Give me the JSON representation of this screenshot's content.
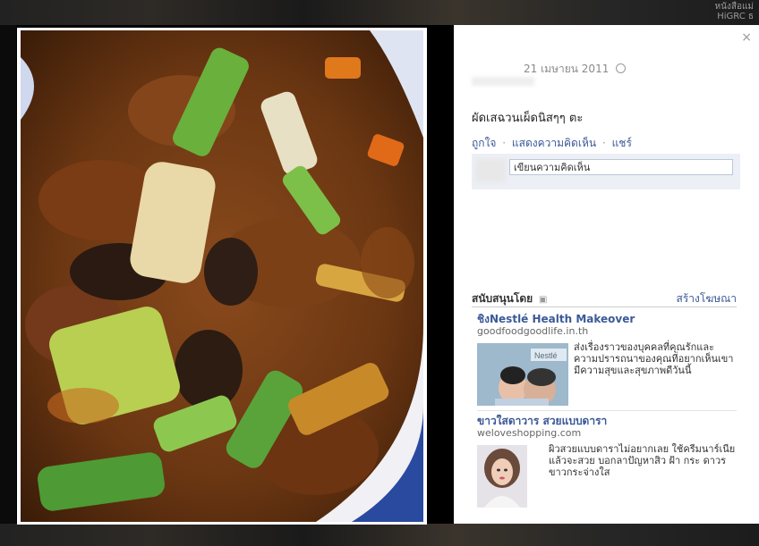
{
  "background": {
    "topright_text_line1": "หนังสือแม่",
    "topright_text_line2": "HiGRC ธ"
  },
  "viewer": {
    "close_label": "×",
    "date": "21 เมษายน 2011",
    "caption": "ผัดเสฉวนเผ็ดนิสๆๆ ตะ",
    "actions": {
      "like": "ถูกใจ",
      "comment": "แสดงความคิดเห็น",
      "share": "แชร์",
      "separator": "·"
    },
    "comment_placeholder": "เขียนความคิดเห็น"
  },
  "sponsored": {
    "label": "สนับสนุนโดย",
    "create_ad": "สร้างโฆษณา",
    "ads": [
      {
        "title": "ชิงNestlé Health Makeover",
        "url": "goodfoodgoodlife.in.th",
        "text": "ส่งเรื่องราวของบุคคลที่คุณรักและความปรารถนาของคุณที่อยากเห็นเขามีความสุขและสุขภาพดีวันนี้",
        "image_label": "Nestlé"
      },
      {
        "title": "ขาวใสดาวาร สวยแบบดารา",
        "url": "weloveshopping.com",
        "text": "ผิวสวยแบบดาราไม่อยากเลย ใช้ครีมนาร์เนียแล้วจะสวย บอกลาปัญหาสิว ฝ้า กระ ดาวร ขาวกระจ่างใส"
      }
    ]
  },
  "colors": {
    "link": "#3b5998",
    "overlay": "#000000",
    "comment_bg": "#eceff5"
  },
  "icons": {
    "globe": "globe-icon",
    "sponsored": "sponsored-icon",
    "close": "close-icon"
  }
}
